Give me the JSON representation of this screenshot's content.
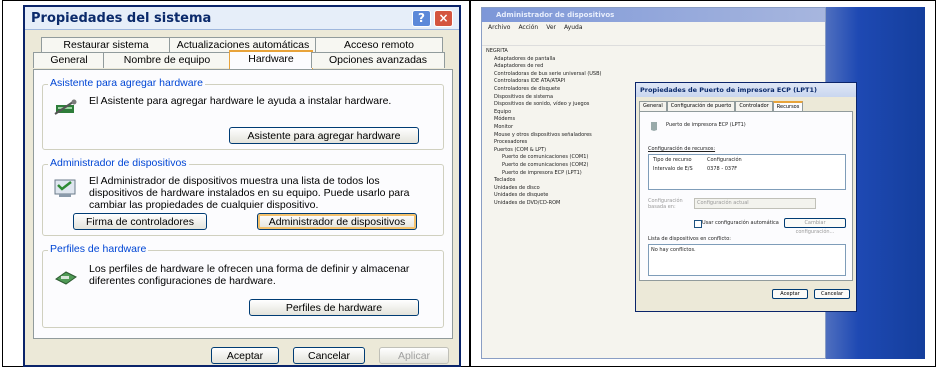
{
  "system_props": {
    "title": "Propiedades del sistema",
    "help_glyph": "?",
    "close_glyph": "×",
    "tabs_row1": [
      "Restaurar sistema",
      "Actualizaciones automáticas",
      "Acceso remoto"
    ],
    "tabs_row2": [
      "General",
      "Nombre de equipo",
      "Hardware",
      "Opciones avanzadas"
    ],
    "active_tab": "Hardware",
    "groups": {
      "wizard": {
        "title": "Asistente para agregar hardware",
        "text": "El Asistente para agregar hardware le ayuda a instalar hardware.",
        "button": "Asistente para agregar hardware"
      },
      "device_manager": {
        "title": "Administrador de dispositivos",
        "text": "El Administrador de dispositivos muestra una lista de todos los dispositivos de hardware instalados en su equipo. Puede usarlo para cambiar las propiedades de cualquier dispositivo.",
        "button_signing": "Firma de controladores",
        "button_manager": "Administrador de dispositivos"
      },
      "profiles": {
        "title": "Perfiles de hardware",
        "text": "Los perfiles de hardware le ofrecen una forma de definir y almacenar diferentes configuraciones de hardware.",
        "button": "Perfiles de hardware"
      }
    },
    "footer": {
      "ok": "Aceptar",
      "cancel": "Cancelar",
      "apply": "Aplicar"
    }
  },
  "device_manager_window": {
    "title": "Administrador de dispositivos",
    "menu": [
      "Archivo",
      "Acción",
      "Ver",
      "Ayuda"
    ],
    "tree_root": "NEGRITA",
    "tree_items": [
      "Adaptadores de pantalla",
      "Adaptadores de red",
      "Controladoras de bus serie universal (USB)",
      "Controladoras IDE ATA/ATAPI",
      "Controladores de disquete",
      "Dispositivos de sistema",
      "Dispositivos de sonido, vídeo y juegos",
      "Equipo",
      "Módems",
      "Monitor",
      "Mouse y otros dispositivos señaladores",
      "Procesadores",
      "Puertos (COM & LPT)",
      "Puerto de comunicaciones (COM1)",
      "Puerto de comunicaciones (COM2)",
      "Puerto de impresora ECP (LPT1)",
      "Teclados",
      "Unidades de disco",
      "Unidades de disquete",
      "Unidades de DVD/CD-ROM"
    ]
  },
  "lpt_dialog": {
    "title": "Propiedades de Puerto de impresora ECP (LPT1)",
    "tabs": [
      "General",
      "Configuración de puerto",
      "Controlador",
      "Recursos"
    ],
    "active_tab": "Recursos",
    "device_name": "Puerto de impresora ECP (LPT1)",
    "resources_label": "Configuración de recursos:",
    "col_type": "Tipo de recurso",
    "col_config": "Configuración",
    "row_type": "Intervalo de E/S",
    "row_value": "0378 - 037F",
    "based_on_label": "Configuración basada en:",
    "based_on_value": "Configuración actual",
    "auto_config": "Usar configuración automática",
    "change_config": "Cambiar configuración...",
    "conflicts_label": "Lista de dispositivos en conflicto:",
    "conflicts_value": "No hay conflictos.",
    "ok": "Aceptar",
    "cancel": "Cancelar"
  }
}
